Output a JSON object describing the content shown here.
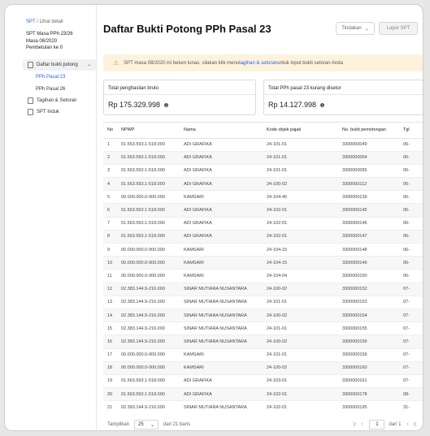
{
  "breadcrumb": {
    "link": "SPT",
    "separator": " / ",
    "current": "Lihat detail"
  },
  "spt_info": {
    "line1": "SPT Masa PPh 23/26",
    "line2": "Masa 08/2020",
    "line3": "Pembetulan ke 0"
  },
  "sidebar": {
    "group_label": "Daftar bukti potong",
    "sub_items": [
      "PPh Pasal 23",
      "PPh Pasal 26"
    ],
    "items": [
      "Tagihan & Setoran",
      "SPT Induk"
    ]
  },
  "header": {
    "title": "Daftar Bukti Potong PPh Pasal 23",
    "action_button": "Tindakan",
    "report_button": "Lapor SPT"
  },
  "alert": {
    "text_before": "SPT masa 08/2020 ini belum lunas, silakan klik menu ",
    "link": "tagihan & setoran",
    "text_after": " untuk input bukti setoran Anda"
  },
  "summary": {
    "bruto_label": "Total penghasilan bruto",
    "bruto_value": "Rp 175.329.998",
    "pph_label": "Total PPh pasal 23 kurang disetor",
    "pph_value": "Rp 14.127.998"
  },
  "table": {
    "columns": [
      "No",
      "NPWP",
      "Nama",
      "Kode objek pajak",
      "No. bukti pemotongan",
      "Tgl"
    ],
    "rows": [
      [
        "1",
        "01.563.593.1-518.000",
        "ADI GRAFIKA",
        "24-101-01",
        "3300000049",
        "06-"
      ],
      [
        "2",
        "01.563.593.1-518.000",
        "ADI GRAFIKA",
        "24-101-01",
        "3300000064",
        "06-"
      ],
      [
        "3",
        "01.563.593.1-518.000",
        "ADI GRAFIKA",
        "24-101-01",
        "3300000065",
        "06-"
      ],
      [
        "4",
        "01.563.593.1-518.000",
        "ADI GRAFIKA",
        "24-100-02",
        "3300000112",
        "06-"
      ],
      [
        "5",
        "00.000.000.0-000.000",
        "KAMSARI",
        "24-104-40",
        "3300000139",
        "06-"
      ],
      [
        "6",
        "01.563.593.1-518.000",
        "ADI GRAFIKA",
        "24-102-01",
        "3300000145",
        "06-"
      ],
      [
        "7",
        "01.563.593.1-518.000",
        "ADI GRAFIKA",
        "24-102-01",
        "3300000146",
        "06-"
      ],
      [
        "8",
        "01.563.593.1-518.000",
        "ADI GRAFIKA",
        "24-102-01",
        "3300000147",
        "06-"
      ],
      [
        "9",
        "00.000.000.0-000.000",
        "KAMSARI",
        "24-104-15",
        "3300000148",
        "06-"
      ],
      [
        "10",
        "00.000.000.0-000.000",
        "KAMSARI",
        "24-104-15",
        "3300000149",
        "06-"
      ],
      [
        "11",
        "00.000.000.0-000.000",
        "KAMSARI",
        "24-104-04",
        "3300000150",
        "06-"
      ],
      [
        "12",
        "02.383.144.9-216.000",
        "SINAR MUTIARA NUSANTARA",
        "24-100-02",
        "3300000152",
        "07-"
      ],
      [
        "13",
        "02.383.144.9-216.000",
        "SINAR MUTIARA NUSANTARA",
        "24-101-01",
        "3300000153",
        "07-"
      ],
      [
        "14",
        "02.383.144.9-216.000",
        "SINAR MUTIARA NUSANTARA",
        "24-100-02",
        "3300000154",
        "07-"
      ],
      [
        "15",
        "02.383.144.9-216.000",
        "SINAR MUTIARA NUSANTARA",
        "24-101-01",
        "3300000155",
        "07-"
      ],
      [
        "16",
        "02.383.144.9-216.000",
        "SINAR MUTIARA NUSANTARA",
        "24-100-02",
        "3300000156",
        "07-"
      ],
      [
        "17",
        "00.000.000.0-000.000",
        "KAMSARI",
        "24-101-01",
        "3300000159",
        "07-"
      ],
      [
        "18",
        "00.000.000.0-000.000",
        "KAMSARI",
        "24-100-02",
        "3300000160",
        "07-"
      ],
      [
        "19",
        "01.563.593.1-518.000",
        "ADI GRAFIKA",
        "24-103-01",
        "3300000161",
        "07-"
      ],
      [
        "20",
        "01.563.593.1-518.000",
        "ADI GRAFIKA",
        "24-102-01",
        "3300000178",
        "08-"
      ],
      [
        "21",
        "02.383.144.9-216.000",
        "SINAR MUTIARA NUSANTARA",
        "24-102-01",
        "3300000195",
        "31-"
      ]
    ]
  },
  "pagination": {
    "show_label": "Tampilkan",
    "per_page": "25",
    "of_rows": "dari 21 baris",
    "page": "1",
    "of_pages": "dari 1"
  }
}
